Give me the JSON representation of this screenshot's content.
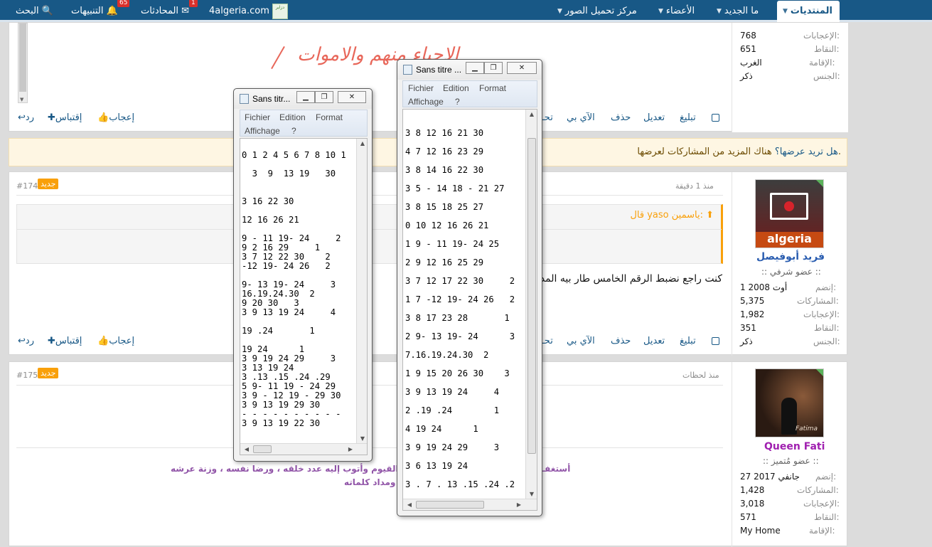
{
  "nav": {
    "forums": "المنتديات",
    "whats_new": "ما الجديد",
    "members": "الأعضاء",
    "upload": "مركز تحميل الصور",
    "site": "4algeria.com",
    "conversations": "المحادثات",
    "conversations_count": "1",
    "alerts": "التنبيهات",
    "alerts_count": "65",
    "search": "البحث"
  },
  "top_post": {
    "sidebar": [
      {
        "label": "الإعجابات:",
        "value": "768"
      },
      {
        "label": "النقاط:",
        "value": "651"
      },
      {
        "label": "الإقامة:",
        "value": "الغرب"
      },
      {
        "label": "الجنس:",
        "value": "ذكر"
      }
    ],
    "handwriting": [
      "الاحياء منهم والاموات"
    ],
    "actions": {
      "report": "تبليغ",
      "edit": "تعديل",
      "delete": "حذف",
      "ip": "الآي بي",
      "warn": "تحـ",
      "like": "إعجاب",
      "quote": "إقتباس",
      "reply": "رد"
    }
  },
  "more_bar": {
    "text": "هناك المزيد من المشاركات لعرضها.",
    "ask": "هل تريد عرضها؟"
  },
  "post174": {
    "number": "#174",
    "badge": "جديد",
    "time": "منذ 1 دقيقة",
    "quote_author": "قال yaso ياسمين:",
    "body": "كنت راجع نضبط الرقم الخامس طار بيه المد",
    "username": "فريد أبوفيصل",
    "usertitle": ":: عضو شرفي ::",
    "sidebar": [
      {
        "label": "إنضم:",
        "value": "1 أوت 2008"
      },
      {
        "label": "المشاركات:",
        "value": "5,375"
      },
      {
        "label": "الإعجابات:",
        "value": "1,982"
      },
      {
        "label": "النقاط:",
        "value": "351"
      },
      {
        "label": "الجنس:",
        "value": "ذكر"
      }
    ],
    "actions": {
      "report": "تبليغ",
      "edit": "تعديل",
      "delete": "حذف",
      "ip": "الآي بي",
      "warn": "تحـ",
      "like": "إعجاب",
      "quote": "إقتباس",
      "reply": "رد"
    }
  },
  "post175": {
    "number": "#175",
    "badge": "جديد",
    "time": "منذ لحظات",
    "sig1": "أستغفـ",
    "sig2": "القيوم وأتوب إليه عدد خلقه ، ورضا نفسه ، وزنة عرشه",
    "sig3": "ومداد كلماته",
    "username": "Queen Fati",
    "usertitle": ":: عضو مُتميز ::",
    "avatar_text": "Fatima",
    "sidebar": [
      {
        "label": "إنضم:",
        "value": "27 جانفي 2017"
      },
      {
        "label": "المشاركات:",
        "value": "1,428"
      },
      {
        "label": "الإعجابات:",
        "value": "3,018"
      },
      {
        "label": "النقاط:",
        "value": "571"
      },
      {
        "label": "الإقامة:",
        "value": "My Home"
      }
    ]
  },
  "notepad1": {
    "title": "Sans titr...",
    "menu": [
      "Fichier",
      "Edition",
      "Format",
      "Affichage",
      "?"
    ],
    "lines": [
      "",
      "0 1 2 4 5 6 7 8 10 1",
      "",
      "  3  9  13 19   30",
      "",
      "",
      "3 16 22 30",
      "",
      "12 16 26 21",
      "",
      "9 - 11 19- 24     2",
      "9 2 16 29     1",
      "3 7 12 22 30    2",
      "-12 19- 24 26   2",
      "",
      "9- 13 19- 24     3",
      "16.19.24.30  2",
      "9 20 30   3",
      "3 9 13 19 24     4",
      "",
      "19 .24       1",
      "",
      "19 24      1",
      "3 9 19 24 29     3",
      "3 13 19 24",
      "3 .13 .15 .24 .29",
      "5 9- 11 19 - 24 29",
      "3 9 - 12 19 - 29 30",
      "3 9 13 19 29 30",
      "- - - - - - - - - -",
      "3 9 13 19 22 30"
    ]
  },
  "notepad2": {
    "title": "Sans titre ...",
    "menu": [
      "Fichier",
      "Edition",
      "Format",
      "Affichage",
      "?"
    ],
    "lines": [
      "",
      "3 8 12 16 21 30",
      "",
      "4 7 12 16 23 29",
      "",
      "3 8 14 16 22 30",
      "",
      "3 5 - 14 18 - 21 27",
      "",
      "3 8 15 18 25 27",
      "",
      "0 10 12 16 26 21",
      "",
      "1 9 - 11 19- 24 25",
      "",
      "2 9 12 16 25 29",
      "",
      "3 7 12 17 22 30     2",
      "",
      "1 7 -12 19- 24 26   2",
      "",
      "3 8 17 23 28       1",
      "",
      "2 9- 13 19- 24      3",
      "",
      "7.16.19.24.30  2",
      "",
      "1 9 15 20 26 30    3",
      "",
      "3 9 13 19 24     4",
      "",
      "2 .19 .24        1",
      "",
      "4 19 24      1",
      "",
      "3 9 19 24 29     3",
      "",
      "3 6 13 19 24",
      "",
      "3 . 7 . 13 .15 .24 .2"
    ]
  }
}
